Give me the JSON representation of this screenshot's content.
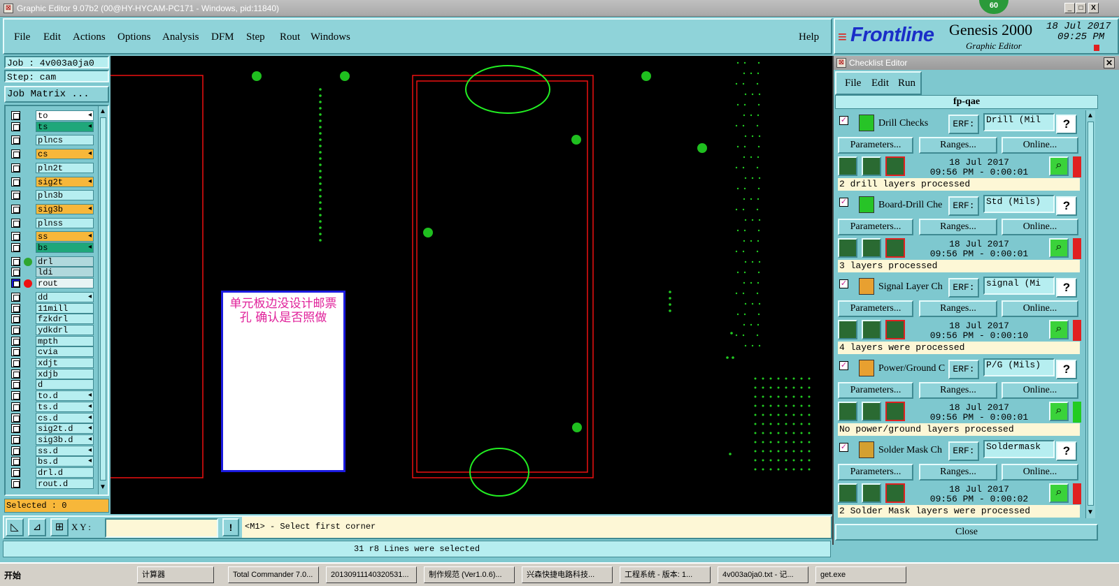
{
  "window": {
    "title": "Graphic Editor 9.07b2 (00@HY-HYCAM-PC171 - Windows, pid:11840)",
    "badge": "60",
    "controls": {
      "minimize": "_",
      "maximize": "□",
      "close": "X"
    }
  },
  "menu": {
    "items": [
      "File",
      "Edit",
      "Actions",
      "Options",
      "Analysis",
      "DFM",
      "Step",
      "Rout",
      "Windows"
    ],
    "help": "Help"
  },
  "brand": {
    "logo": "Frontline",
    "product": "Genesis 2000",
    "subtitle": "Graphic Editor",
    "date": "18 Jul 2017",
    "time": "09:25 PM"
  },
  "left_panel": {
    "job": "Job : 4v003a0ja0",
    "step": "Step: cam",
    "job_matrix": "Job Matrix ...",
    "layers": [
      {
        "name": "to",
        "color": "#ffffff",
        "tick": true
      },
      {
        "name": "ts",
        "color": "#1fa77a",
        "tick": true
      },
      {
        "name": "plncs",
        "color": "#b6eef0",
        "tick": false
      },
      {
        "name": "cs",
        "color": "#f7b73a",
        "tick": true
      },
      {
        "name": "pln2t",
        "color": "#b6eef0",
        "tick": false
      },
      {
        "name": "sig2t",
        "color": "#f7b73a",
        "tick": true
      },
      {
        "name": "pln3b",
        "color": "#b6eef0",
        "tick": false
      },
      {
        "name": "sig3b",
        "color": "#f7b73a",
        "tick": true
      },
      {
        "name": "plnss",
        "color": "#b6eef0",
        "tick": false
      },
      {
        "name": "ss",
        "color": "#f7b73a",
        "tick": true
      },
      {
        "name": "bs",
        "color": "#1fa77a",
        "tick": true
      },
      {
        "name": "drl",
        "color": "#b0d8dc",
        "tick": false,
        "dot": "#2fa62f"
      },
      {
        "name": "ldi",
        "color": "#b0d8dc",
        "tick": false
      },
      {
        "name": "rout",
        "color": "#e8f4f4",
        "tick": false,
        "dot": "#ee1111",
        "selected": true
      },
      {
        "name": "dd",
        "color": "#b6eef0",
        "tick": true
      },
      {
        "name": "11mill",
        "color": "#b6eef0",
        "tick": false
      },
      {
        "name": "fzkdrl",
        "color": "#b6eef0",
        "tick": false
      },
      {
        "name": "ydkdrl",
        "color": "#b6eef0",
        "tick": false
      },
      {
        "name": "mpth",
        "color": "#b6eef0",
        "tick": false
      },
      {
        "name": "cvia",
        "color": "#b6eef0",
        "tick": false
      },
      {
        "name": "xdjt",
        "color": "#b6eef0",
        "tick": false
      },
      {
        "name": "xdjb",
        "color": "#b6eef0",
        "tick": false
      },
      {
        "name": "d",
        "color": "#b6eef0",
        "tick": false
      },
      {
        "name": "to.d",
        "color": "#b6eef0",
        "tick": true
      },
      {
        "name": "ts.d",
        "color": "#b6eef0",
        "tick": true
      },
      {
        "name": "cs.d",
        "color": "#b6eef0",
        "tick": true
      },
      {
        "name": "sig2t.d",
        "color": "#b6eef0",
        "tick": true
      },
      {
        "name": "sig3b.d",
        "color": "#b6eef0",
        "tick": true
      },
      {
        "name": "ss.d",
        "color": "#b6eef0",
        "tick": true
      },
      {
        "name": "bs.d",
        "color": "#b6eef0",
        "tick": true
      },
      {
        "name": "drl.d",
        "color": "#b6eef0",
        "tick": false
      },
      {
        "name": "rout.d",
        "color": "#b6eef0",
        "tick": false
      }
    ],
    "selected": "Selected : 0"
  },
  "canvas": {
    "note": "单元板边没设计邮票孔  确认是否照做"
  },
  "xy_bar": {
    "label": "X Y :",
    "input_value": "",
    "info_button": "!",
    "prompt": "<M1> - Select first corner"
  },
  "status": "31 r8 Lines were selected",
  "checklist": {
    "title": "Checklist Editor",
    "menu": [
      "File",
      "Edit",
      "Run"
    ],
    "name": "fp-qae",
    "erf_label": "ERF:",
    "help": "?",
    "buttons": {
      "parameters": "Parameters...",
      "ranges": "Ranges...",
      "online": "Online..."
    },
    "close": "Close",
    "items": [
      {
        "title": "Drill Checks",
        "erf": "Drill (Mil",
        "date": "18 Jul 2017",
        "time": "09:56 PM - 0:00:01",
        "status": "2 drill layers processed",
        "flag": "#e02020",
        "icon_color": "#27c427"
      },
      {
        "title": "Board-Drill Che",
        "erf": "Std (Mils)",
        "date": "18 Jul 2017",
        "time": "09:56 PM - 0:00:01",
        "status": "3 layers processed",
        "flag": "#e02020",
        "icon_color": "#27c427"
      },
      {
        "title": "Signal Layer Ch",
        "erf": "signal (Mi",
        "date": "18 Jul 2017",
        "time": "09:56 PM - 0:00:10",
        "status": "4 layers were processed",
        "flag": "#e02020",
        "icon_color": "#e8a030"
      },
      {
        "title": "Power/Ground C",
        "erf": "P/G (Mils)",
        "date": "18 Jul 2017",
        "time": "09:56 PM - 0:00:01",
        "status": "No power/ground layers processed",
        "flag": "#22cc22",
        "icon_color": "#e8a030"
      },
      {
        "title": "Solder Mask Ch",
        "erf": "Soldermask",
        "date": "18 Jul 2017",
        "time": "09:56 PM - 0:00:02",
        "status": "2 Solder Mask layers were processed",
        "flag": "#e02020",
        "icon_color": "#d4a030"
      }
    ]
  },
  "taskbar": {
    "start": "开始",
    "items": [
      "计算器",
      "Total Commander 7.0...",
      "20130911140320531...",
      "制作规范 (Ver1.0.6)...",
      "兴森快捷电路科技...",
      "工程系统 - 版本: 1...",
      "4v003a0ja0.txt - 记...",
      "get.exe"
    ]
  }
}
